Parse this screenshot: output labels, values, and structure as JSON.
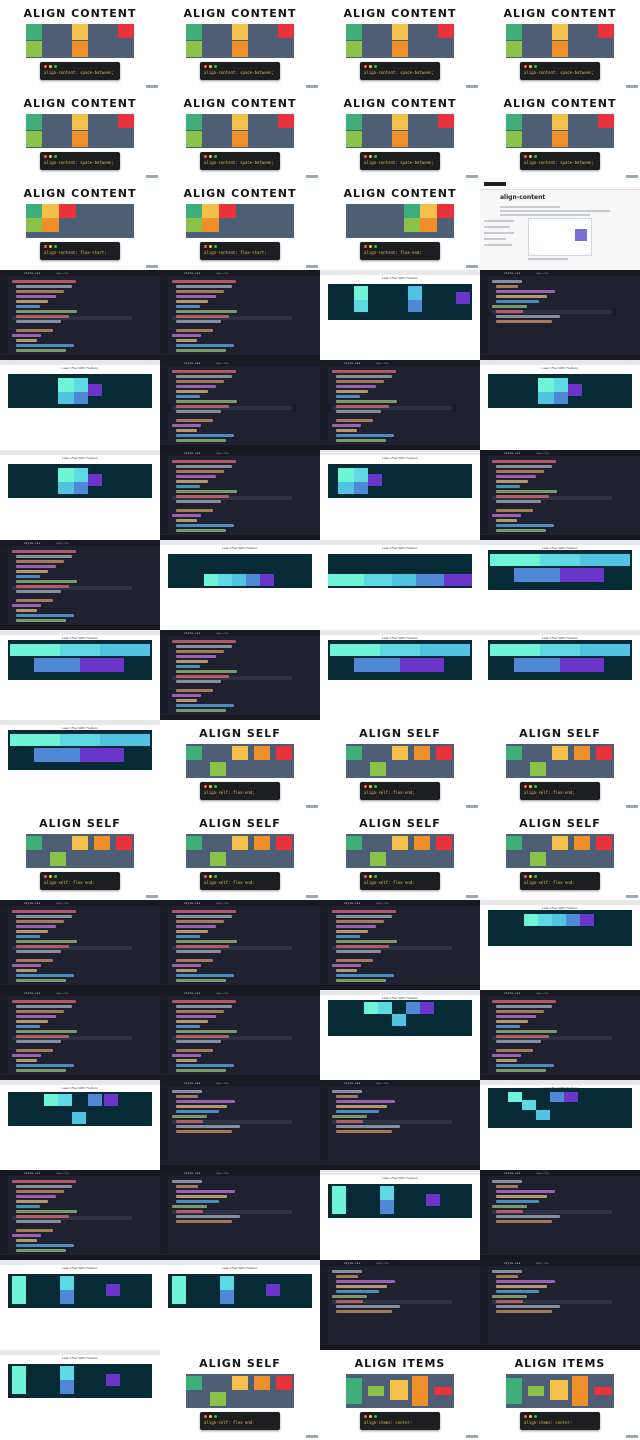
{
  "slides": {
    "align_content": "ALIGN CONTENT",
    "align_self": "ALIGN SELF",
    "align_items": "ALIGN ITEMS"
  },
  "commands": {
    "space_between": "align-content: space-between;",
    "flex_start": "align-content: flex-start;",
    "flex_end": "align-content: flex-end;",
    "self_flex_end": "align-self: flex-end;",
    "items_center": "align-items: center;"
  },
  "doc": {
    "heading": "align-content"
  },
  "browser": {
    "title": "Learn Flex With Flexbox"
  },
  "editor": {
    "tab": "style.css",
    "tab2": "app.css"
  },
  "colors": {
    "green": "#3fae7a",
    "lightgreen": "#8bc34a",
    "yellow": "#f3c04c",
    "orange": "#ef8f2c",
    "red": "#e8323c",
    "slate": "#4e5f75",
    "container": "#072a37",
    "mint": "#6ff3d6",
    "aqua": "#5ed9e3",
    "cyan": "#4fc3df",
    "blue": "#4f88d4",
    "purple": "#6a35c9"
  }
}
